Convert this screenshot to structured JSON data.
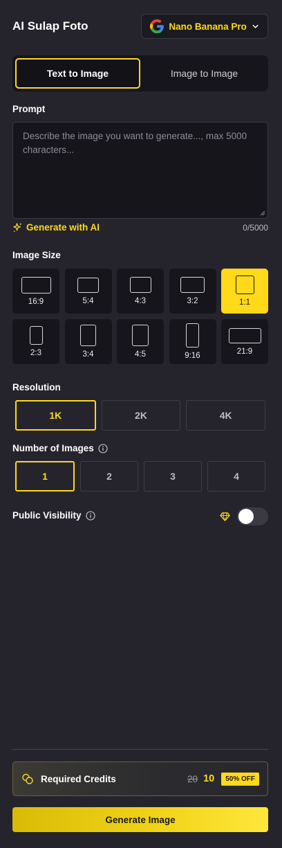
{
  "header": {
    "app_title": "AI Sulap Foto",
    "model": {
      "label": "Nano Banana Pro",
      "icon": "google-icon"
    }
  },
  "mode_tabs": [
    {
      "label": "Text to Image",
      "active": true
    },
    {
      "label": "Image to Image",
      "active": false
    }
  ],
  "prompt": {
    "label": "Prompt",
    "placeholder": "Describe the image you want to generate..., max 5000 characters...",
    "value": "",
    "generate_with_ai": "Generate with AI",
    "char_count": "0/5000"
  },
  "image_size": {
    "label": "Image Size",
    "options": [
      {
        "label": "16:9",
        "active": false
      },
      {
        "label": "5:4",
        "active": false
      },
      {
        "label": "4:3",
        "active": false
      },
      {
        "label": "3:2",
        "active": false
      },
      {
        "label": "1:1",
        "active": true
      },
      {
        "label": "2:3",
        "active": false
      },
      {
        "label": "3:4",
        "active": false
      },
      {
        "label": "4:5",
        "active": false
      },
      {
        "label": "9:16",
        "active": false
      },
      {
        "label": "21:9",
        "active": false
      }
    ]
  },
  "resolution": {
    "label": "Resolution",
    "options": [
      "1K",
      "2K",
      "4K"
    ],
    "selected": "1K"
  },
  "num_images": {
    "label": "Number of Images",
    "options": [
      "1",
      "2",
      "3",
      "4"
    ],
    "selected": "1"
  },
  "visibility": {
    "label": "Public Visibility",
    "premium_icon": "diamond-icon",
    "enabled": false
  },
  "credits": {
    "label": "Required Credits",
    "old_value": "20",
    "new_value": "10",
    "badge": "50% OFF"
  },
  "generate_button": "Generate Image",
  "colors": {
    "background": "#25242c",
    "panel": "#16151b",
    "accent": "#ffd91a",
    "border": "#3e3d46"
  }
}
